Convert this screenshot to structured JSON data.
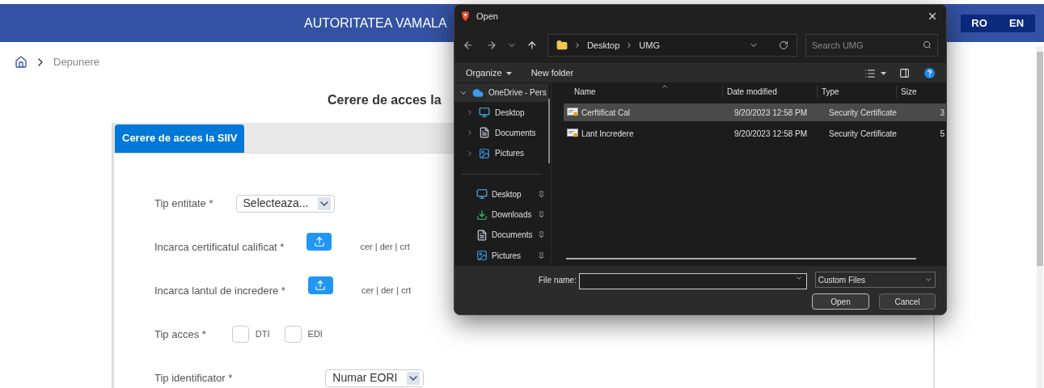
{
  "header": {
    "title": "AUTORITATEA VAMALA",
    "languages": [
      "RO",
      "EN"
    ]
  },
  "breadcrumb": [
    "Depunere"
  ],
  "page_title": "Cerere de acces la",
  "tabs": [
    {
      "label": "Cerere de acces la SIIV",
      "selected": true
    }
  ],
  "form": [
    {
      "kind": "select",
      "label": "Tip entitate *",
      "value": "Selecteaza..."
    },
    {
      "kind": "upload",
      "label": "Incarca certificatul calificat *",
      "hint": "cer | der | crt"
    },
    {
      "kind": "upload",
      "label": "Incarca lantul de incredere *",
      "hint": "cer | der | crt"
    },
    {
      "kind": "checkboxes",
      "label": "Tip acces *",
      "options": [
        {
          "label": "DTI",
          "checked": false
        },
        {
          "label": "EDI",
          "checked": false
        }
      ]
    },
    {
      "kind": "select",
      "label": "Tip identificator *",
      "value": "Numar EORI"
    }
  ],
  "dialog": {
    "title": "Open",
    "address": [
      "Desktop",
      "UMG"
    ],
    "search_placeholder": "Search UMG",
    "toolbar": [
      "Organize",
      "New folder"
    ],
    "nav": [
      {
        "label": "OneDrive - Pers",
        "kind": "cloud",
        "expanded": true,
        "selected": true,
        "children": [
          {
            "label": "Desktop",
            "kind": "desktop",
            "expanded": false,
            "selected": false
          },
          {
            "label": "Documents",
            "kind": "documents",
            "expanded": false,
            "selected": false
          },
          {
            "label": "Pictures",
            "kind": "pictures",
            "expanded": false,
            "selected": false
          }
        ]
      }
    ],
    "quick_access": [
      {
        "label": "Desktop",
        "kind": "desktop",
        "pinned": true
      },
      {
        "label": "Downloads",
        "kind": "downloads",
        "pinned": true
      },
      {
        "label": "Documents",
        "kind": "documents",
        "pinned": true
      },
      {
        "label": "Pictures",
        "kind": "pictures",
        "pinned": true
      }
    ],
    "columns": [
      "Name",
      "Date modified",
      "Type",
      "Size"
    ],
    "files": [
      {
        "name": "Cerftificat Cal",
        "date": "9/20/2023 12:58 PM",
        "type": "Security Certificate",
        "size": "3",
        "selected": true
      },
      {
        "name": "Lant Incredere",
        "date": "9/20/2023 12:58 PM",
        "type": "Security Certificate",
        "size": "5",
        "selected": false
      }
    ],
    "file_name_label": "File name:",
    "file_type": "Custom Files",
    "buttons": [
      "Open",
      "Cancel"
    ]
  }
}
